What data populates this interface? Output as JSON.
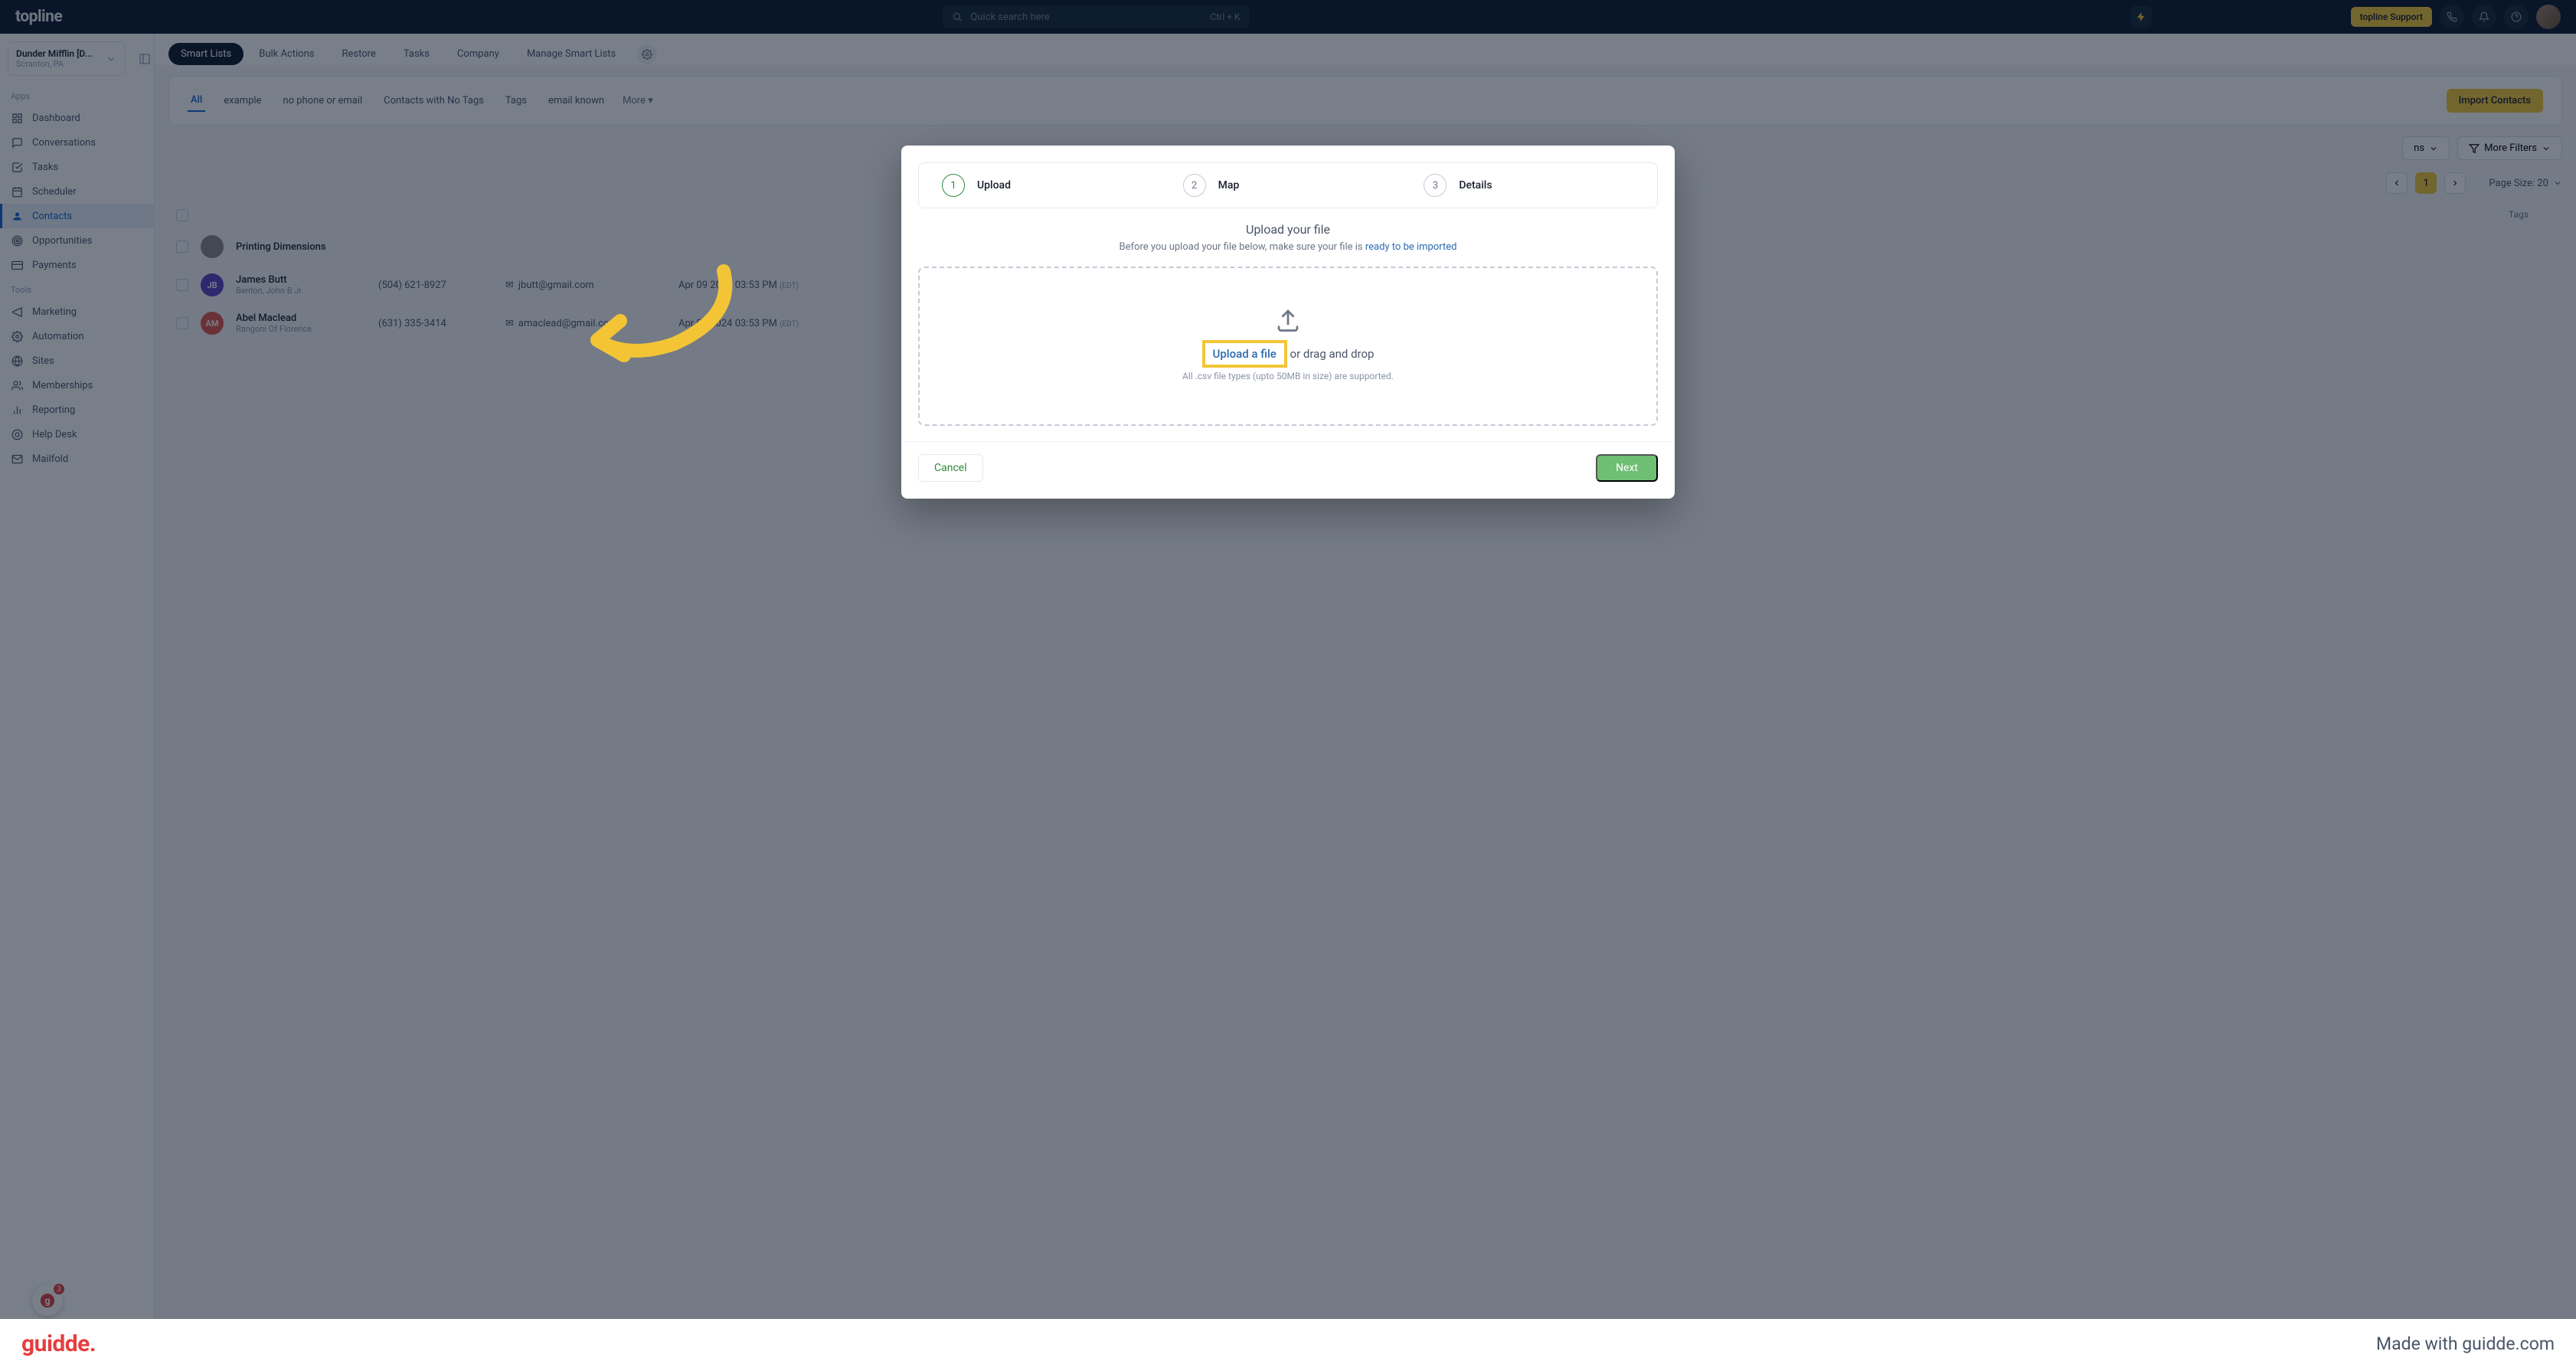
{
  "header": {
    "logo": "topline",
    "search_placeholder": "Quick search here",
    "shortcut": "Ctrl + K",
    "support_label": "topline Support"
  },
  "account": {
    "name": "Dunder Mifflin [D...",
    "location": "Scranton, PA"
  },
  "sidebar": {
    "apps_label": "Apps",
    "tools_label": "Tools",
    "apps": [
      "Dashboard",
      "Conversations",
      "Tasks",
      "Scheduler",
      "Contacts",
      "Opportunities",
      "Payments"
    ],
    "tools": [
      "Marketing",
      "Automation",
      "Sites",
      "Memberships",
      "Reporting",
      "Help Desk",
      "Mailfold"
    ],
    "guidde_badge": "3"
  },
  "main_tabs": [
    "Smart Lists",
    "Bulk Actions",
    "Restore",
    "Tasks",
    "Company",
    "Manage Smart Lists"
  ],
  "filter_tabs": [
    "All",
    "example",
    "no phone or email",
    "Contacts with No Tags",
    "Tags",
    "email known"
  ],
  "more_label": "More",
  "import_btn": "Import Contacts",
  "columns_btn_suffix": "ns",
  "more_filters": "More Filters",
  "page": "1",
  "page_size_label": "Page Size: 20",
  "tags_header": "Tags",
  "contacts": [
    {
      "initials": "",
      "color": "#888",
      "name": "Printing Dimensions",
      "sub": "",
      "phone": "",
      "email": "",
      "date": ""
    },
    {
      "initials": "JB",
      "color": "#5c3fc4",
      "name": "James Butt",
      "sub": "Benton, John B Jr",
      "phone": "(504) 621-8927",
      "email": "jbutt@gmail.com",
      "date": "Apr 09 2024 03:53 PM",
      "tz": "(EDT)"
    },
    {
      "initials": "AM",
      "color": "#e0524f",
      "name": "Abel Maclead",
      "sub": "Rangoni Of Florence",
      "phone": "(631) 335-3414",
      "email": "amaclead@gmail.com",
      "date": "Apr 09 2024 03:53 PM",
      "tz": "(EDT)"
    }
  ],
  "modal": {
    "steps": [
      "Upload",
      "Map",
      "Details"
    ],
    "title": "Upload your file",
    "desc_pre": "Before you upload your file below, make sure your file is ",
    "desc_link": "ready to be imported",
    "upload_link": "Upload a file",
    "upload_rest": " or drag and drop",
    "upload_sub": "All .csv file types (upto 50MB in size) are supported.",
    "cancel": "Cancel",
    "next": "Next"
  },
  "footer": {
    "logo": "guidde.",
    "made_with": "Made with guidde.com"
  }
}
